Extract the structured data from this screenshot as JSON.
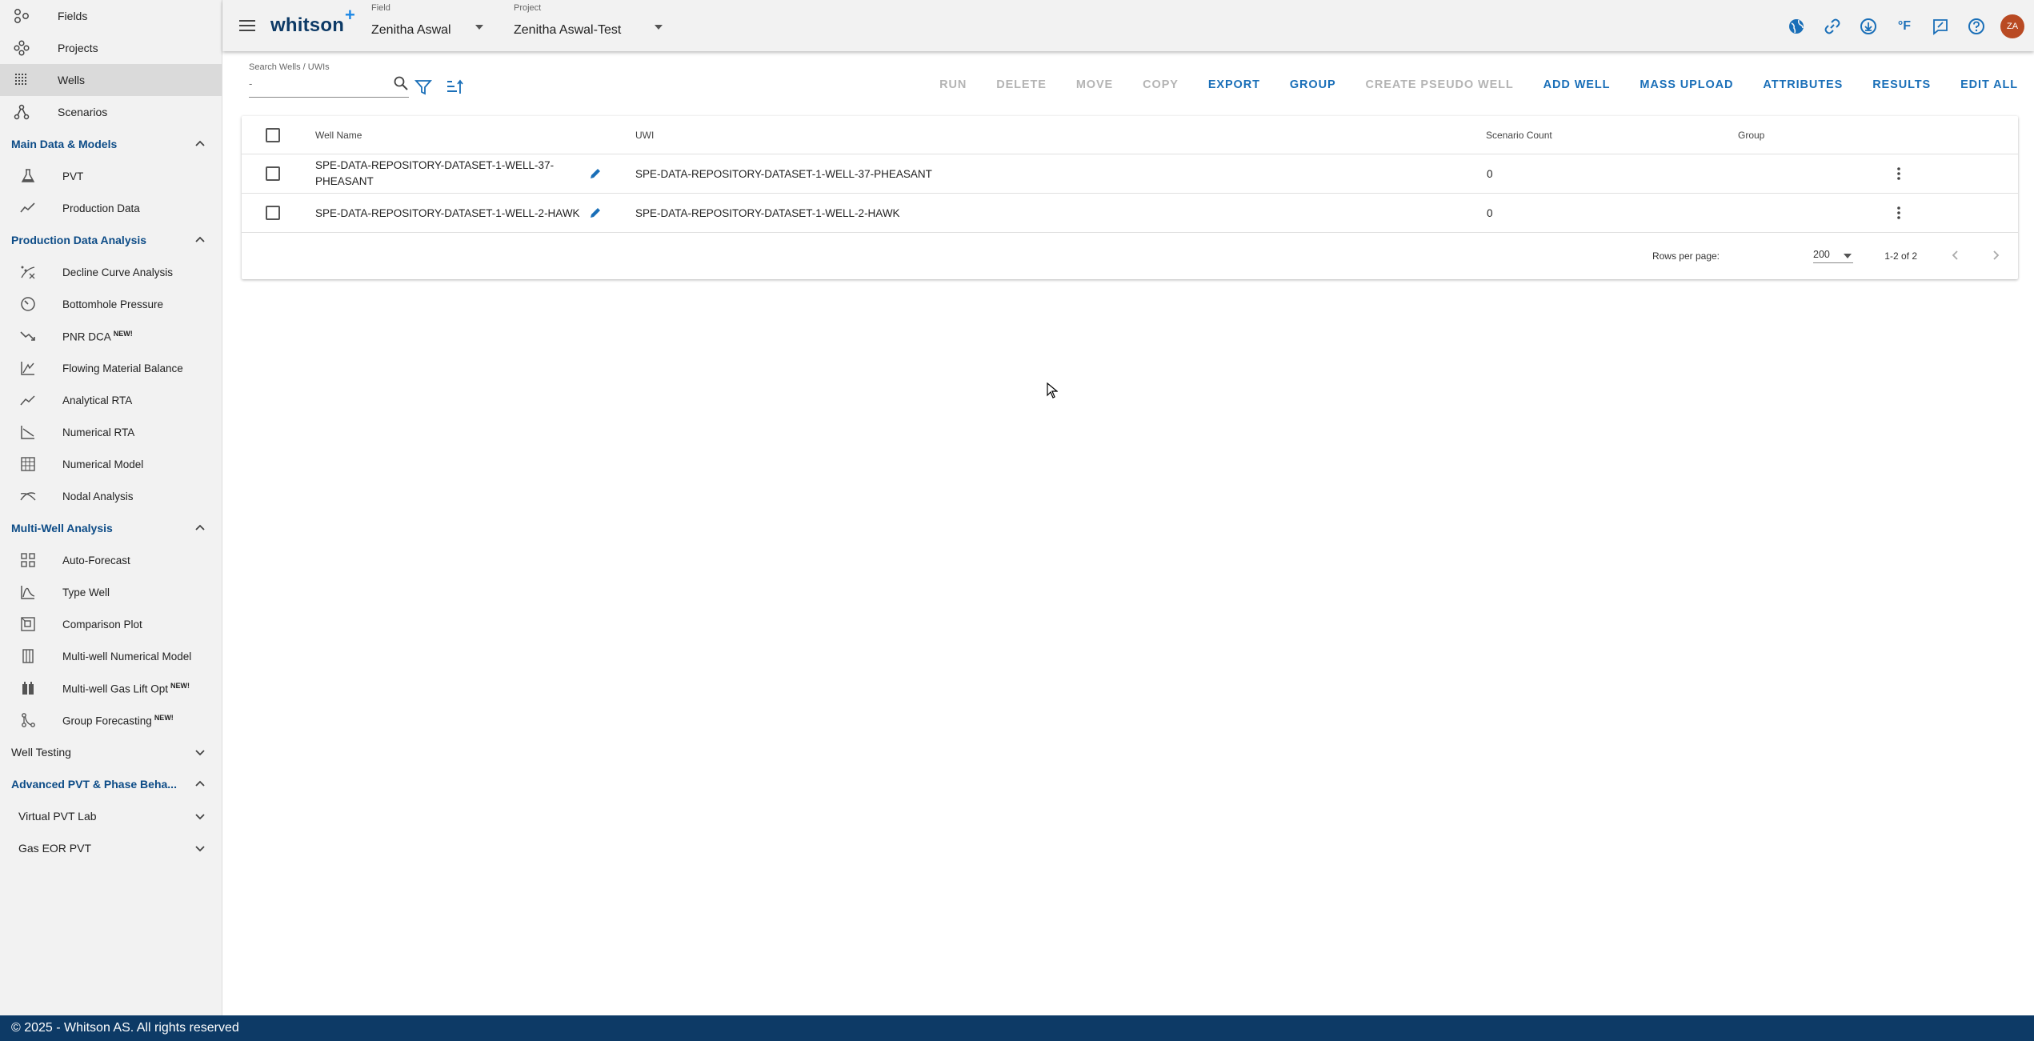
{
  "app": {
    "logo": "whitson",
    "logo_plus": "+"
  },
  "header": {
    "field_label": "Field",
    "field_value": "Zenitha Aswal",
    "project_label": "Project",
    "project_value": "Zenitha Aswal-Test",
    "unit_label": "°F",
    "avatar_initials": "ZA"
  },
  "sidebar": {
    "top_items": [
      {
        "label": "Fields",
        "icon": "fields-icon"
      },
      {
        "label": "Projects",
        "icon": "projects-icon"
      },
      {
        "label": "Wells",
        "icon": "wells-icon",
        "active": true
      },
      {
        "label": "Scenarios",
        "icon": "scenarios-icon"
      }
    ],
    "sections": {
      "main_data": {
        "label": "Main Data & Models",
        "items": [
          "PVT",
          "Production Data"
        ]
      },
      "pda": {
        "label": "Production Data Analysis",
        "items": [
          "Decline Curve Analysis",
          "Bottomhole Pressure",
          "PNR DCA",
          "Flowing Material Balance",
          "Analytical RTA",
          "Numerical RTA",
          "Numerical Model",
          "Nodal Analysis"
        ]
      },
      "multi": {
        "label": "Multi-Well Analysis",
        "items": [
          "Auto-Forecast",
          "Type Well",
          "Comparison Plot",
          "Multi-well Numerical Model",
          "Multi-well Gas Lift Opt",
          "Group Forecasting"
        ]
      },
      "well_testing": {
        "label": "Well Testing"
      },
      "advanced": {
        "label": "Advanced PVT & Phase Beha...",
        "items": [
          "Virtual PVT Lab",
          "Gas EOR PVT"
        ]
      }
    },
    "new_badge": "NEW!"
  },
  "toolbar": {
    "search_label": "Search Wells / UWIs",
    "search_placeholder": "-",
    "actions": [
      {
        "label": "RUN",
        "enabled": false
      },
      {
        "label": "DELETE",
        "enabled": false
      },
      {
        "label": "MOVE",
        "enabled": false
      },
      {
        "label": "COPY",
        "enabled": false
      },
      {
        "label": "EXPORT",
        "enabled": true
      },
      {
        "label": "GROUP",
        "enabled": true
      },
      {
        "label": "CREATE PSEUDO WELL",
        "enabled": false
      },
      {
        "label": "ADD WELL",
        "enabled": true
      },
      {
        "label": "MASS UPLOAD",
        "enabled": true
      },
      {
        "label": "ATTRIBUTES",
        "enabled": true
      },
      {
        "label": "RESULTS",
        "enabled": true
      },
      {
        "label": "EDIT ALL",
        "enabled": true
      }
    ]
  },
  "table": {
    "columns": [
      "Well Name",
      "UWI",
      "Scenario Count",
      "Group"
    ],
    "rows": [
      {
        "name_line1": "SPE-DATA-REPOSITORY-DATASET-1-WELL-37-",
        "name_line2": "PHEASANT",
        "uwi": "SPE-DATA-REPOSITORY-DATASET-1-WELL-37-PHEASANT",
        "scenario_count": "0",
        "group": ""
      },
      {
        "name_line1": "SPE-DATA-REPOSITORY-DATASET-1-WELL-2-HAWK",
        "name_line2": "",
        "uwi": "SPE-DATA-REPOSITORY-DATASET-1-WELL-2-HAWK",
        "scenario_count": "0",
        "group": ""
      }
    ],
    "rows_per_page_label": "Rows per page:",
    "rows_per_page_value": "200",
    "range_text": "1-2 of 2"
  },
  "footer": {
    "copyright": "© 2025 - Whitson AS. All rights reserved"
  },
  "colors": {
    "accent": "#1a6fb8",
    "brand_dark": "#0d3a66",
    "section_header": "#0d4c87",
    "avatar": "#b94a23"
  }
}
